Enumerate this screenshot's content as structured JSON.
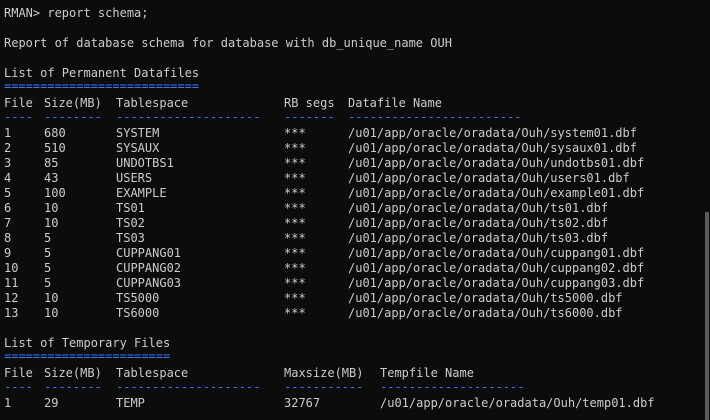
{
  "window": {
    "background": "#0c0c0c",
    "text_color": "#cccccc",
    "separator_color": "#3b78ff"
  },
  "prompt": "RMAN> report schema;",
  "report_title": "Report of database schema for database with db_unique_name OUH",
  "permanent": {
    "heading": "List of Permanent Datafiles",
    "underline": "===========================",
    "headers": {
      "file": "File",
      "size": "Size(MB)",
      "tablespace": "Tablespace",
      "rb": "RB segs",
      "name": "Datafile Name"
    },
    "separators": {
      "file": "----",
      "size": "--------",
      "tablespace": "--------------------",
      "rb": "-------",
      "name": "------------------------"
    },
    "rows": [
      {
        "file": "1",
        "size": "680",
        "tablespace": "SYSTEM",
        "rb": "***",
        "name": "/u01/app/oracle/oradata/Ouh/system01.dbf"
      },
      {
        "file": "2",
        "size": "510",
        "tablespace": "SYSAUX",
        "rb": "***",
        "name": "/u01/app/oracle/oradata/Ouh/sysaux01.dbf"
      },
      {
        "file": "3",
        "size": "85",
        "tablespace": "UNDOTBS1",
        "rb": "***",
        "name": "/u01/app/oracle/oradata/Ouh/undotbs01.dbf"
      },
      {
        "file": "4",
        "size": "43",
        "tablespace": "USERS",
        "rb": "***",
        "name": "/u01/app/oracle/oradata/Ouh/users01.dbf"
      },
      {
        "file": "5",
        "size": "100",
        "tablespace": "EXAMPLE",
        "rb": "***",
        "name": "/u01/app/oracle/oradata/Ouh/example01.dbf"
      },
      {
        "file": "6",
        "size": "10",
        "tablespace": "TS01",
        "rb": "***",
        "name": "/u01/app/oracle/oradata/Ouh/ts01.dbf"
      },
      {
        "file": "7",
        "size": "10",
        "tablespace": "TS02",
        "rb": "***",
        "name": "/u01/app/oracle/oradata/Ouh/ts02.dbf"
      },
      {
        "file": "8",
        "size": "5",
        "tablespace": "TS03",
        "rb": "***",
        "name": "/u01/app/oracle/oradata/Ouh/ts03.dbf"
      },
      {
        "file": "9",
        "size": "5",
        "tablespace": "CUPPANG01",
        "rb": "***",
        "name": "/u01/app/oracle/oradata/Ouh/cuppang01.dbf"
      },
      {
        "file": "10",
        "size": "5",
        "tablespace": "CUPPANG02",
        "rb": "***",
        "name": "/u01/app/oracle/oradata/Ouh/cuppang02.dbf"
      },
      {
        "file": "11",
        "size": "5",
        "tablespace": "CUPPANG03",
        "rb": "***",
        "name": "/u01/app/oracle/oradata/Ouh/cuppang03.dbf"
      },
      {
        "file": "12",
        "size": "10",
        "tablespace": "TS5000",
        "rb": "***",
        "name": "/u01/app/oracle/oradata/Ouh/ts5000.dbf"
      },
      {
        "file": "13",
        "size": "10",
        "tablespace": "TS6000",
        "rb": "***",
        "name": "/u01/app/oracle/oradata/Ouh/ts6000.dbf"
      }
    ]
  },
  "temporary": {
    "heading": "List of Temporary Files",
    "underline": "=======================",
    "headers": {
      "file": "File",
      "size": "Size(MB)",
      "tablespace": "Tablespace",
      "maxsize": "Maxsize(MB)",
      "name": "Tempfile Name"
    },
    "separators": {
      "file": "----",
      "size": "--------",
      "tablespace": "--------------------",
      "maxsize": "-----------",
      "name": "--------------------"
    },
    "rows": [
      {
        "file": "1",
        "size": "29",
        "tablespace": "TEMP",
        "maxsize": "32767",
        "name": "/u01/app/oracle/oradata/Ouh/temp01.dbf"
      }
    ]
  }
}
